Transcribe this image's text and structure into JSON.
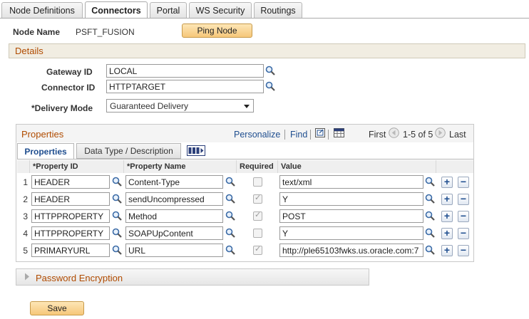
{
  "tabs": [
    {
      "label": "Node Definitions",
      "active": false
    },
    {
      "label": "Connectors",
      "active": true
    },
    {
      "label": "Portal",
      "active": false
    },
    {
      "label": "WS Security",
      "active": false
    },
    {
      "label": "Routings",
      "active": false
    }
  ],
  "node": {
    "label": "Node Name",
    "value": "PSFT_FUSION",
    "ping_button": "Ping Node"
  },
  "details": {
    "title": "Details",
    "gateway_label": "Gateway ID",
    "gateway_value": "LOCAL",
    "connector_label": "Connector ID",
    "connector_value": "HTTPTARGET",
    "delivery_label": "*Delivery Mode",
    "delivery_value": "Guaranteed Delivery"
  },
  "properties": {
    "title": "Properties",
    "personalize": "Personalize",
    "find": "Find",
    "first": "First",
    "range": "1-5 of 5",
    "last": "Last",
    "subtabs": [
      "Properties",
      "Data Type / Description"
    ],
    "columns": [
      "*Property ID",
      "*Property Name",
      "Required",
      "Value"
    ],
    "rows": [
      {
        "num": "1",
        "id": "HEADER",
        "name": "Content-Type",
        "required": false,
        "value": "text/xml"
      },
      {
        "num": "2",
        "id": "HEADER",
        "name": "sendUncompressed",
        "required": true,
        "value": "Y"
      },
      {
        "num": "3",
        "id": "HTTPPROPERTY",
        "name": "Method",
        "required": true,
        "value": "POST"
      },
      {
        "num": "4",
        "id": "HTTPPROPERTY",
        "name": "SOAPUpContent",
        "required": false,
        "value": "Y"
      },
      {
        "num": "5",
        "id": "PRIMARYURL",
        "name": "URL",
        "required": true,
        "value": "http://ple65103fwks.us.oracle.com:7"
      }
    ]
  },
  "password_encryption": {
    "label": "Password Encryption"
  },
  "save_button": "Save",
  "colors": {
    "accent": "#b04b00",
    "link": "#1f4e8f",
    "button": "#f6c77a"
  }
}
